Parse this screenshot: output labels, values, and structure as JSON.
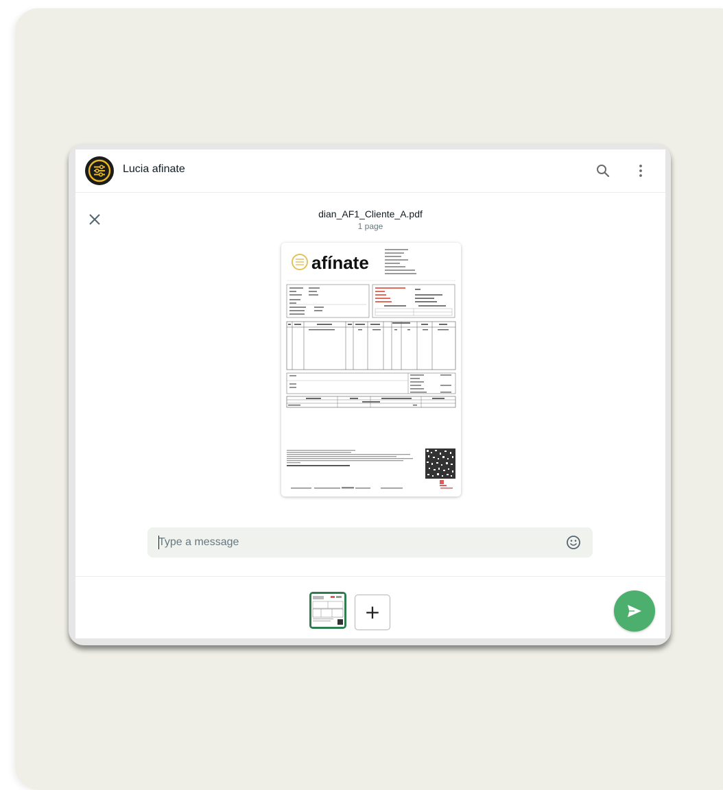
{
  "chat": {
    "contact_name": "Lucia afinate"
  },
  "document": {
    "file_name": "dian_AF1_Cliente_A.pdf",
    "page_count": "1 page",
    "preview": {
      "brand": "afínate"
    }
  },
  "composer": {
    "placeholder": "Type a message"
  },
  "icons": {
    "avatar": "afinate-logo-icon",
    "search": "search-icon",
    "menu": "more-vertical-icon",
    "close": "close-icon",
    "emoji": "emoji-icon",
    "add": "plus-icon",
    "send": "send-icon"
  },
  "colors": {
    "send_button": "#4caf6d",
    "thumbnail_border": "#2e7d4f",
    "brand_gold": "#c9a227"
  }
}
